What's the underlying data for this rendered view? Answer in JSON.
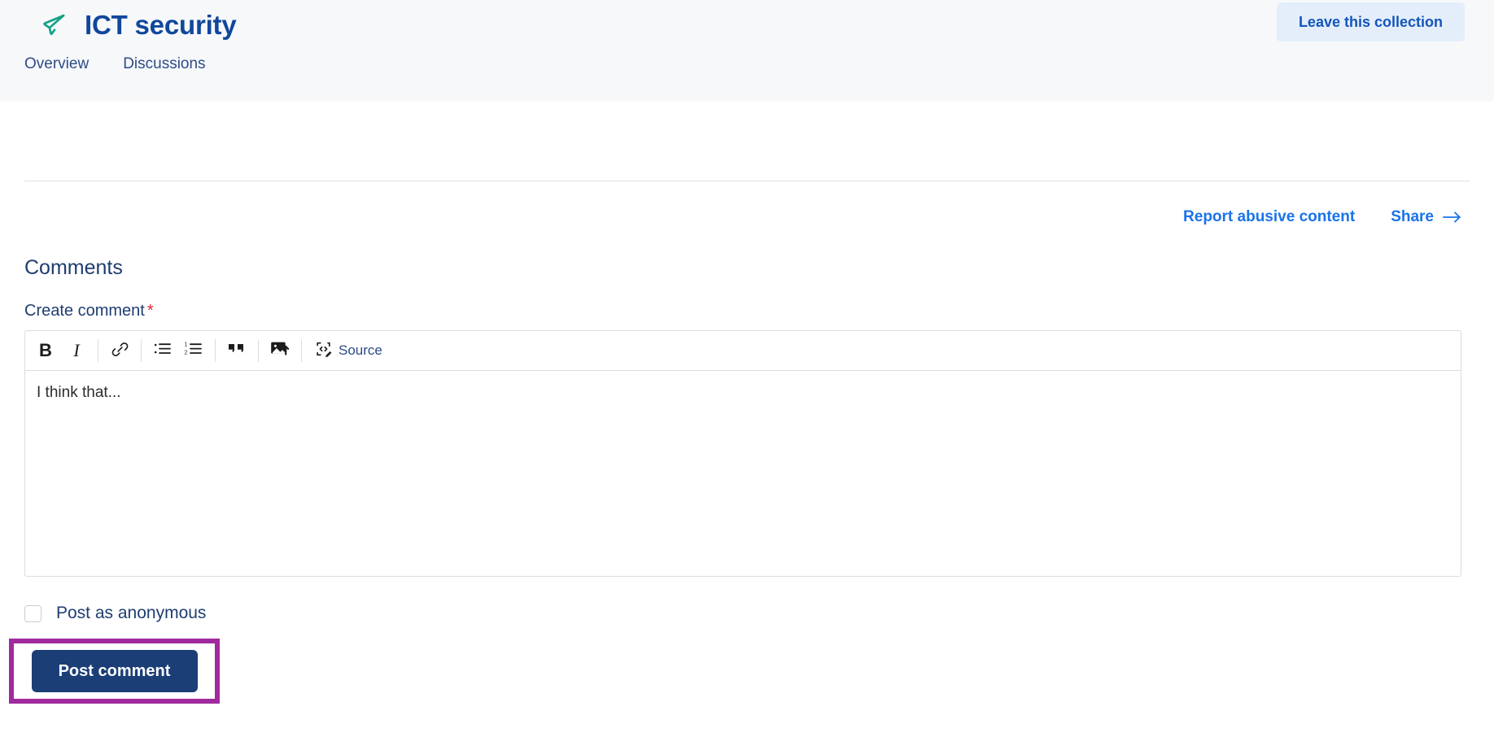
{
  "header": {
    "brand_icon": "paper-plane-icon",
    "title": "ICT security",
    "leave_button": "Leave this collection",
    "tabs": [
      {
        "label": "Overview"
      },
      {
        "label": "Discussions"
      }
    ]
  },
  "content": {
    "actions": [
      {
        "label": "Report abusive content",
        "icon": null
      },
      {
        "label": "Share",
        "icon": "arrow-right-icon"
      }
    ],
    "comments_heading": "Comments",
    "create_comment_label": "Create comment",
    "required_marker": "*"
  },
  "editor": {
    "toolbar": [
      {
        "name": "bold-button",
        "glyph": "B"
      },
      {
        "name": "italic-button",
        "glyph": "I"
      },
      {
        "name": "link-button",
        "glyph": "link-icon"
      },
      {
        "name": "bulleted-list-button",
        "glyph": "bulleted-list-icon"
      },
      {
        "name": "numbered-list-button",
        "glyph": "numbered-list-icon"
      },
      {
        "name": "blockquote-button",
        "glyph": "quote-icon"
      },
      {
        "name": "insert-image-button",
        "glyph": "image-upload-icon"
      },
      {
        "name": "source-button",
        "glyph": "code-edit-icon"
      }
    ],
    "source_label": "Source",
    "body_text": "I think that..."
  },
  "footer": {
    "anonymous_label": "Post as anonymous",
    "anonymous_checked": false,
    "post_button": "Post comment"
  },
  "colors": {
    "header_bg": "#f6f8fa",
    "title_blue": "#10479b",
    "link_blue": "#1a73e8",
    "navy": "#1f3d72",
    "button_navy": "#1b3e77",
    "leave_btn_bg": "#e4eefb",
    "brand_teal": "#16a085",
    "required_red": "#e1243b",
    "highlight_purple": "#a02b9e"
  }
}
